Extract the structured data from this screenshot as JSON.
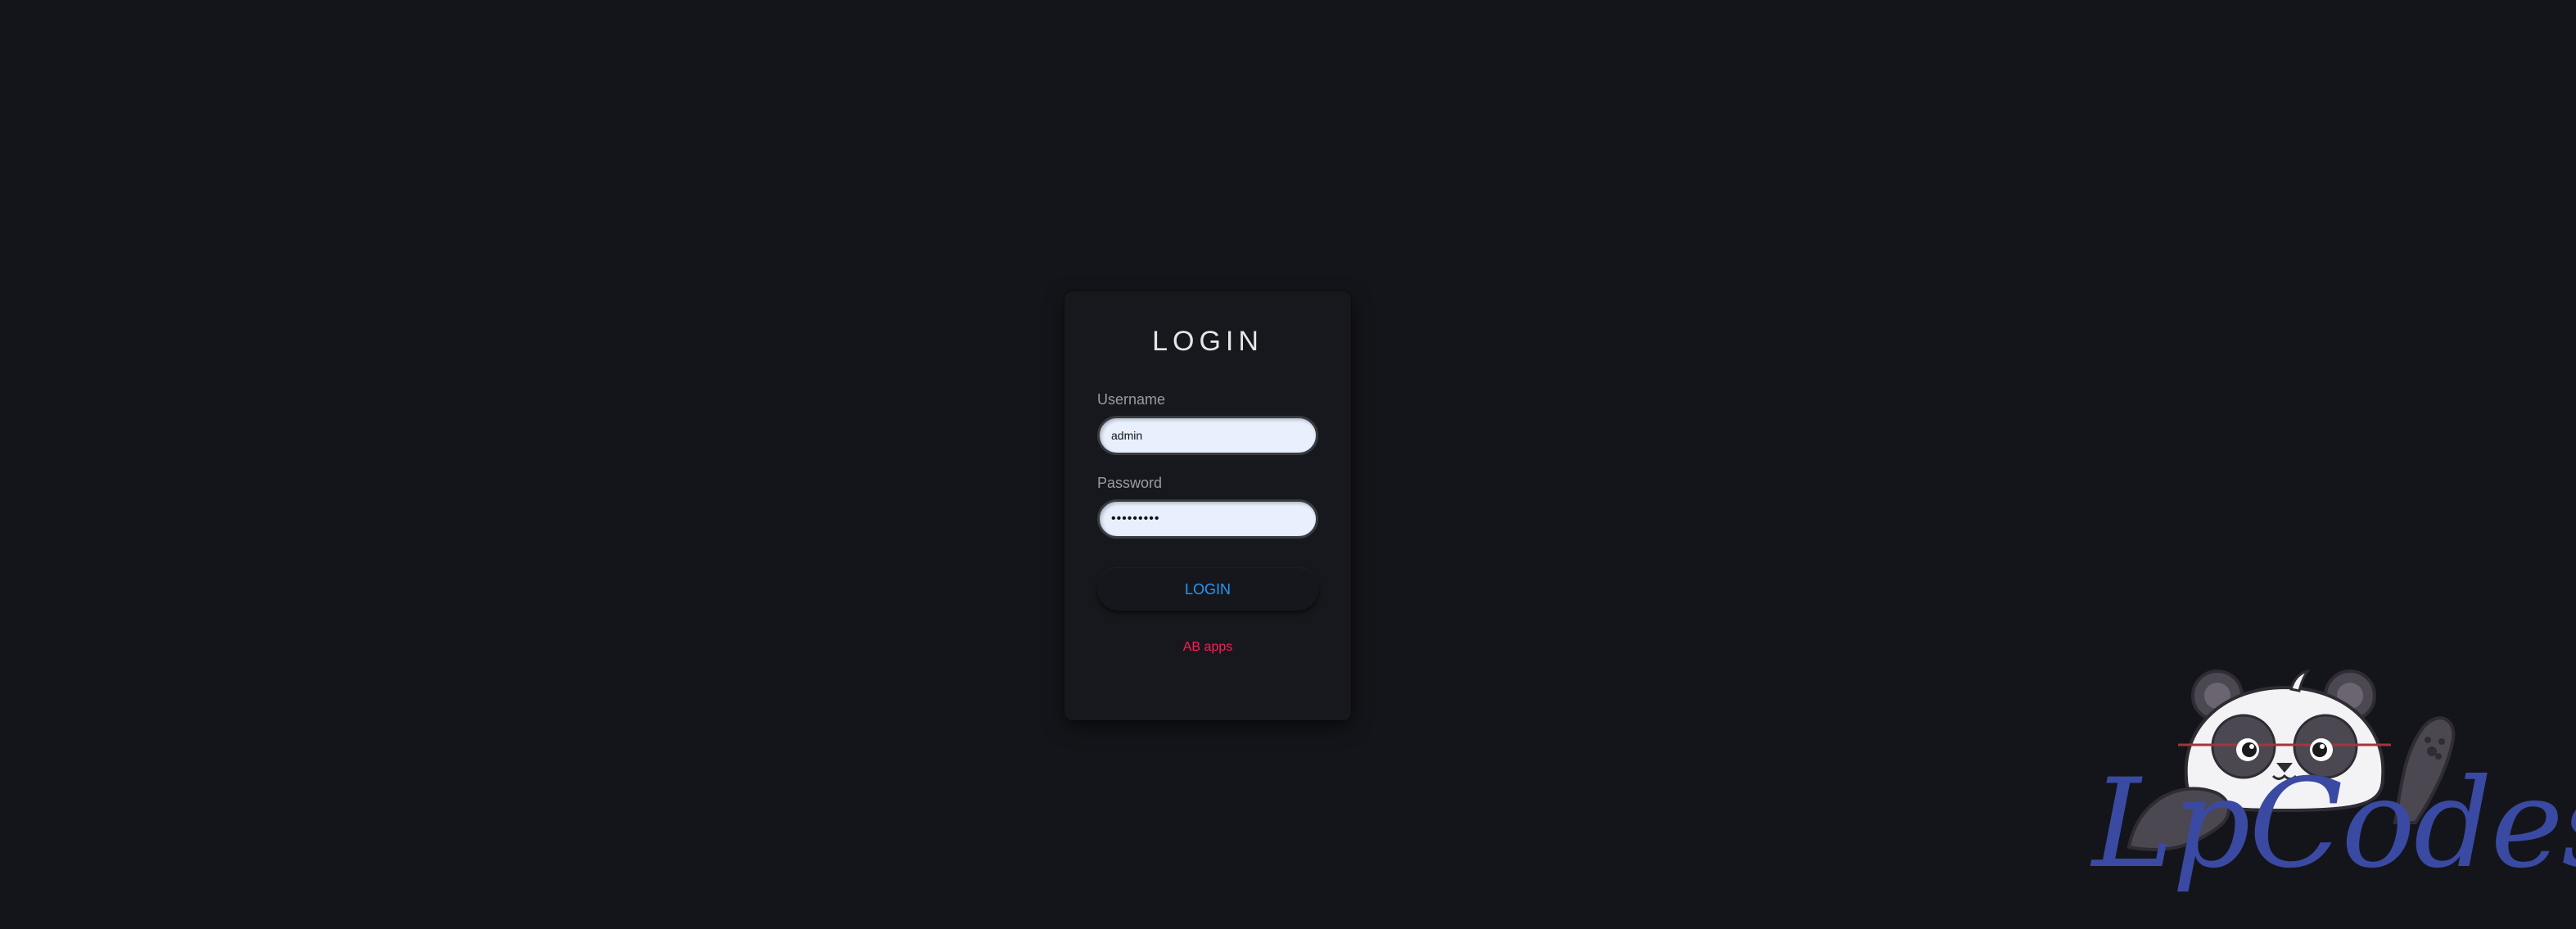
{
  "login": {
    "title": "LOGIN",
    "username_label": "Username",
    "username_value": "admin",
    "password_label": "Password",
    "password_value": "•••••••••",
    "submit_label": "LOGIN",
    "link_label": "AB apps"
  },
  "branding": {
    "logo_text": "LpCodes",
    "mascot": "panda-mascot-icon"
  },
  "colors": {
    "background": "#14151a",
    "card": "#17181d",
    "input_fill": "#e8f0fe",
    "button_text": "#1e9bff",
    "link_text": "#ff1d57",
    "brand_text": "#3a4aa3"
  }
}
